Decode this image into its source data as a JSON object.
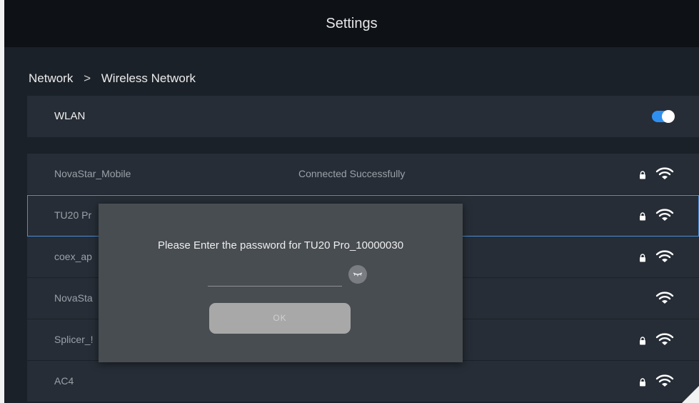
{
  "header": {
    "title": "Settings"
  },
  "breadcrumb": {
    "parent": "Network",
    "separator": ">",
    "current": "Wireless Network"
  },
  "wlan": {
    "label": "WLAN",
    "enabled": true
  },
  "networks": [
    {
      "name": "NovaStar_Mobile",
      "status": "Connected Successfully",
      "secured": true
    },
    {
      "name": "TU20 Pr",
      "status": "",
      "secured": true
    },
    {
      "name": "coex_ap",
      "status": "",
      "secured": true
    },
    {
      "name": "NovaSta",
      "status": "",
      "secured": false
    },
    {
      "name": "Splicer_!",
      "status": "",
      "secured": true
    },
    {
      "name": "AC4",
      "status": "",
      "secured": true
    }
  ],
  "dialog": {
    "message": "Please Enter the password for TU20 Pro_10000030",
    "password_value": "",
    "ok_label": "OK"
  },
  "colors": {
    "accent": "#2f8ff0",
    "background": "#1b2129",
    "row": "#262d36",
    "dialog": "#484d52"
  },
  "icons": {
    "lock": "lock-icon",
    "wifi": "wifi-icon",
    "eye": "eye-closed-icon"
  }
}
